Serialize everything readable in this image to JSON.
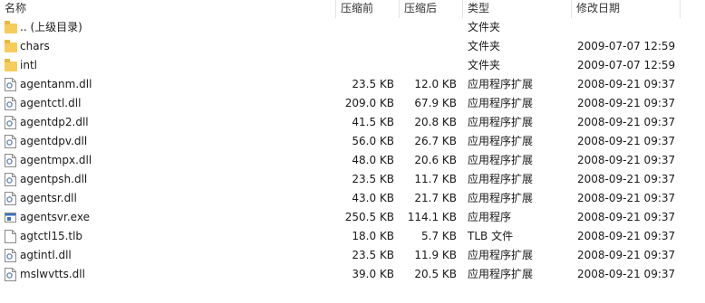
{
  "columns": {
    "name": "名称",
    "original_size": "压缩前",
    "compressed_size": "压缩后",
    "type": "类型",
    "modified": "修改日期"
  },
  "rows": [
    {
      "name": ".. (上级目录)",
      "original_size": "",
      "compressed_size": "",
      "type": "文件夹",
      "modified": "",
      "icon": "folder-icon"
    },
    {
      "name": "chars",
      "original_size": "",
      "compressed_size": "",
      "type": "文件夹",
      "modified": "2009-07-07 12:59",
      "icon": "folder-icon"
    },
    {
      "name": "intl",
      "original_size": "",
      "compressed_size": "",
      "type": "文件夹",
      "modified": "2009-07-07 12:59",
      "icon": "folder-icon"
    },
    {
      "name": "agentanm.dll",
      "original_size": "23.5 KB",
      "compressed_size": "12.0 KB",
      "type": "应用程序扩展",
      "modified": "2008-09-21 09:37",
      "icon": "dll-file-icon"
    },
    {
      "name": "agentctl.dll",
      "original_size": "209.0 KB",
      "compressed_size": "67.9 KB",
      "type": "应用程序扩展",
      "modified": "2008-09-21 09:37",
      "icon": "dll-file-icon"
    },
    {
      "name": "agentdp2.dll",
      "original_size": "41.5 KB",
      "compressed_size": "20.8 KB",
      "type": "应用程序扩展",
      "modified": "2008-09-21 09:37",
      "icon": "dll-file-icon"
    },
    {
      "name": "agentdpv.dll",
      "original_size": "56.0 KB",
      "compressed_size": "26.7 KB",
      "type": "应用程序扩展",
      "modified": "2008-09-21 09:37",
      "icon": "dll-file-icon"
    },
    {
      "name": "agentmpx.dll",
      "original_size": "48.0 KB",
      "compressed_size": "20.6 KB",
      "type": "应用程序扩展",
      "modified": "2008-09-21 09:37",
      "icon": "dll-file-icon"
    },
    {
      "name": "agentpsh.dll",
      "original_size": "23.5 KB",
      "compressed_size": "11.7 KB",
      "type": "应用程序扩展",
      "modified": "2008-09-21 09:37",
      "icon": "dll-file-icon"
    },
    {
      "name": "agentsr.dll",
      "original_size": "43.0 KB",
      "compressed_size": "21.7 KB",
      "type": "应用程序扩展",
      "modified": "2008-09-21 09:37",
      "icon": "dll-file-icon"
    },
    {
      "name": "agentsvr.exe",
      "original_size": "250.5 KB",
      "compressed_size": "114.1 KB",
      "type": "应用程序",
      "modified": "2008-09-21 09:37",
      "icon": "exe-file-icon"
    },
    {
      "name": "agtctl15.tlb",
      "original_size": "18.0 KB",
      "compressed_size": "5.7 KB",
      "type": "TLB 文件",
      "modified": "2008-09-21 09:37",
      "icon": "generic-file-icon"
    },
    {
      "name": "agtintl.dll",
      "original_size": "23.5 KB",
      "compressed_size": "11.9 KB",
      "type": "应用程序扩展",
      "modified": "2008-09-21 09:37",
      "icon": "dll-file-icon"
    },
    {
      "name": "mslwvtts.dll",
      "original_size": "39.0 KB",
      "compressed_size": "20.5 KB",
      "type": "应用程序扩展",
      "modified": "2008-09-21 09:37",
      "icon": "dll-file-icon"
    }
  ]
}
